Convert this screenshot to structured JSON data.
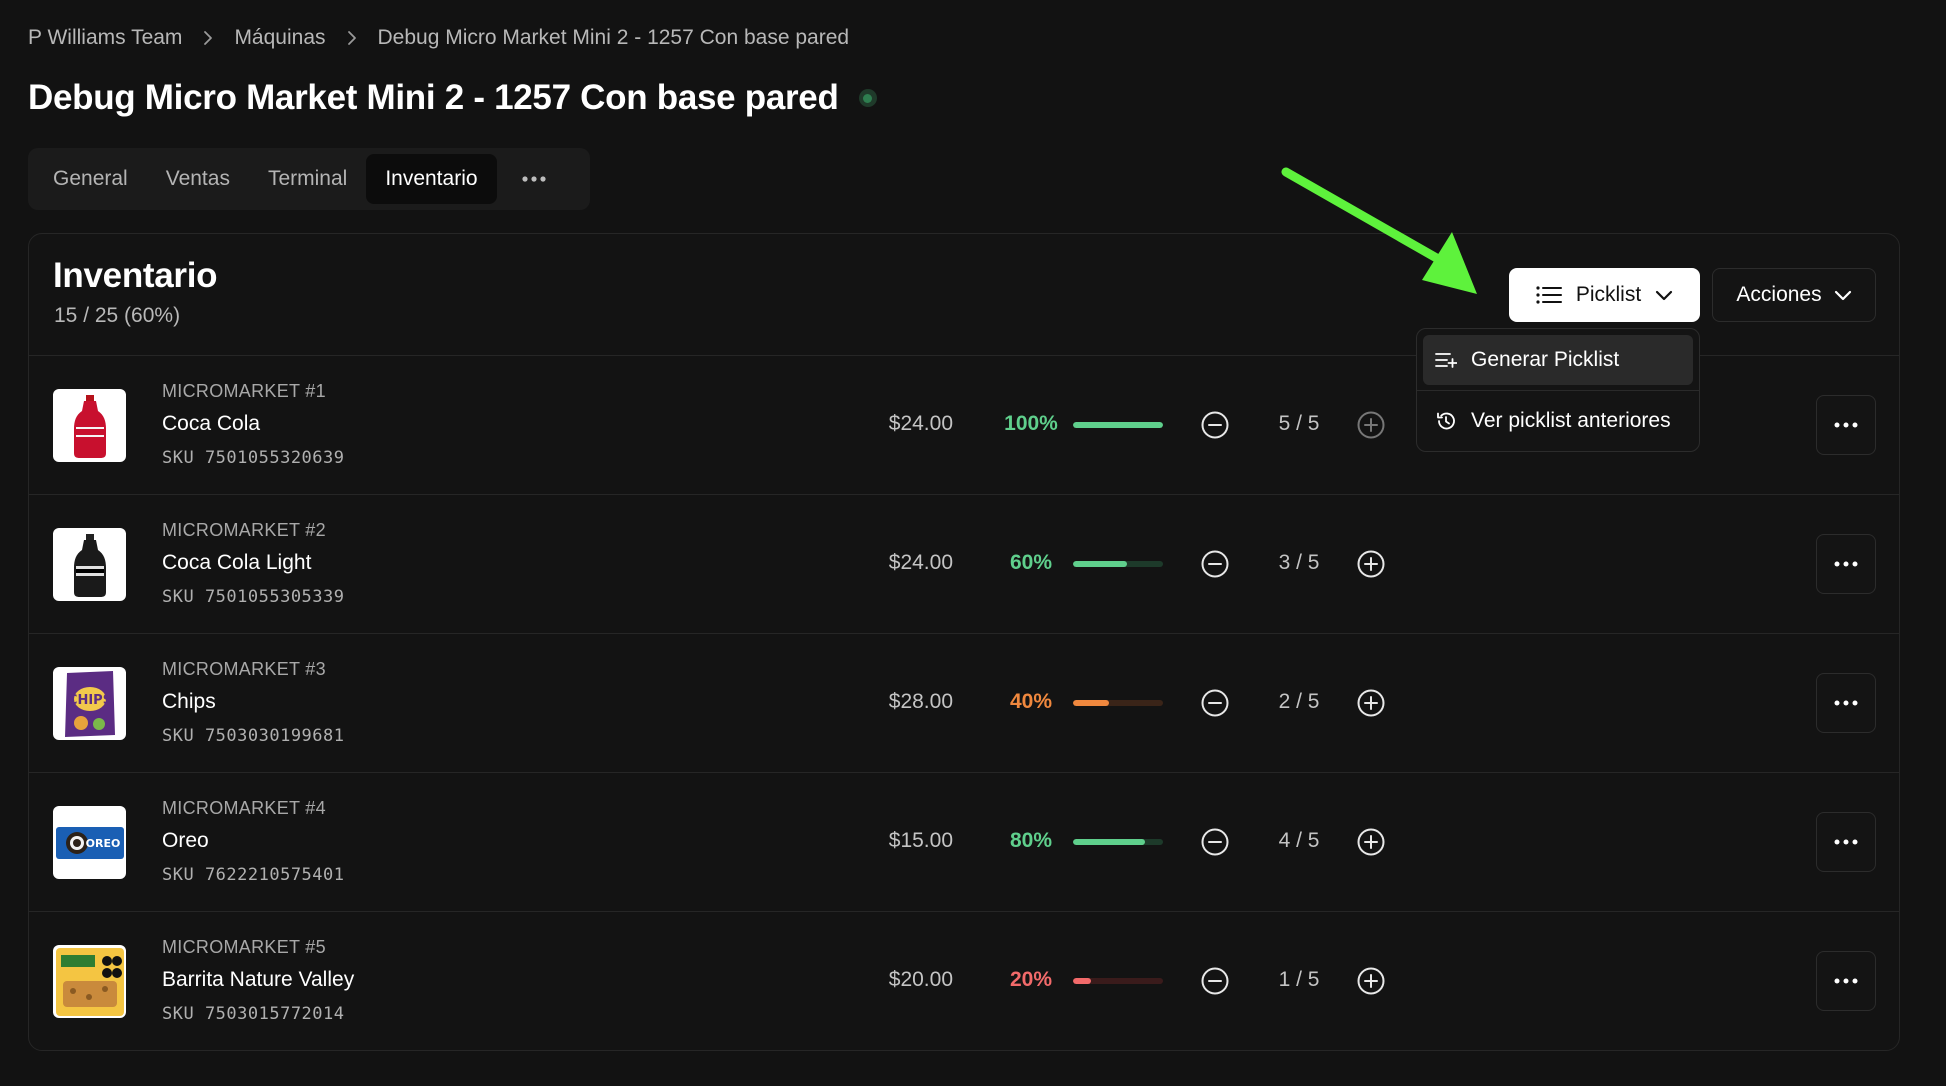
{
  "breadcrumb": {
    "items": [
      "P Williams Team",
      "Máquinas",
      "Debug Micro Market Mini 2 - 1257 Con base pared"
    ]
  },
  "header": {
    "title": "Debug Micro Market Mini 2 - 1257 Con base pared",
    "status_color": "#2e7d4f"
  },
  "tabs": {
    "items": [
      {
        "label": "General"
      },
      {
        "label": "Ventas"
      },
      {
        "label": "Terminal"
      },
      {
        "label": "Inventario"
      }
    ],
    "active": "Inventario",
    "more_icon": "ellipsis-icon"
  },
  "inventory": {
    "title": "Inventario",
    "summary": "15 / 25 (60%)",
    "picklist_button": "Picklist",
    "actions_button": "Acciones",
    "dropdown": {
      "items": [
        {
          "label": "Generar Picklist",
          "icon": "list-add-icon"
        },
        {
          "label": "Ver picklist anteriores",
          "icon": "history-icon"
        }
      ]
    },
    "rows": [
      {
        "slot": "MICROMARKET #1",
        "name": "Coca Cola",
        "sku": "SKU 7501055320639",
        "price": "$24.00",
        "percent_label": "100%",
        "fill": 1.0,
        "level": "green",
        "qty": "5 / 5",
        "image": "coca-cola-bottle"
      },
      {
        "slot": "MICROMARKET #2",
        "name": "Coca Cola Light",
        "sku": "SKU 7501055305339",
        "price": "$24.00",
        "percent_label": "60%",
        "fill": 0.6,
        "level": "green",
        "qty": "3 / 5",
        "image": "coca-cola-light-bottle"
      },
      {
        "slot": "MICROMARKET #3",
        "name": "Chips",
        "sku": "SKU 7503030199681",
        "price": "$28.00",
        "percent_label": "40%",
        "fill": 0.4,
        "level": "orange",
        "qty": "2 / 5",
        "image": "chips-bag"
      },
      {
        "slot": "MICROMARKET #4",
        "name": "Oreo",
        "sku": "SKU 7622210575401",
        "price": "$15.00",
        "percent_label": "80%",
        "fill": 0.8,
        "level": "green",
        "qty": "4 / 5",
        "image": "oreo-pack"
      },
      {
        "slot": "MICROMARKET #5",
        "name": "Barrita Nature Valley",
        "sku": "SKU 7503015772014",
        "price": "$20.00",
        "percent_label": "20%",
        "fill": 0.2,
        "level": "red",
        "qty": "1 / 5",
        "image": "nature-valley-bar"
      }
    ]
  },
  "colors": {
    "green": "#5fcf8c",
    "orange": "#f0883e",
    "red": "#f26a6a",
    "annotation_arrow": "#5ef23c"
  }
}
